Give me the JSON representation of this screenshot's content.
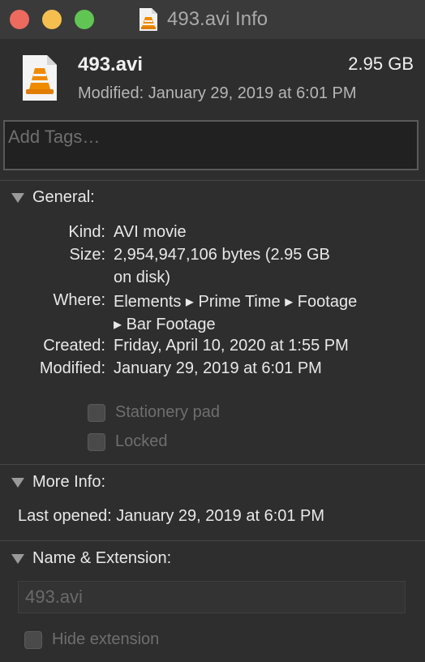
{
  "window": {
    "title": "493.avi Info"
  },
  "file": {
    "name": "493.avi",
    "size": "2.95 GB",
    "modified_line": "Modified: January 29, 2019 at 6:01 PM",
    "icon": "vlc-document-icon"
  },
  "tags": {
    "placeholder": "Add Tags…"
  },
  "general": {
    "heading": "General:",
    "rows": [
      {
        "label": "Kind:",
        "value": "AVI movie"
      },
      {
        "label": "Size:",
        "value": "2,954,947,106 bytes (2.95 GB",
        "value2": "on disk)"
      },
      {
        "label": "Where:",
        "value": "Elements ▸ Prime Time ▸ Footage",
        "value2": "▸ Bar Footage"
      },
      {
        "label": "Created:",
        "value": "Friday, April 10, 2020 at 1:55 PM"
      },
      {
        "label": "Modified:",
        "value": "January 29, 2019 at 6:01 PM"
      }
    ],
    "stationery_label": "Stationery pad",
    "locked_label": "Locked"
  },
  "more_info": {
    "heading": "More Info:",
    "last_opened_label": "Last opened:",
    "last_opened_value": "January 29, 2019 at 6:01 PM"
  },
  "name_extension": {
    "heading": "Name & Extension:",
    "value": "493.avi",
    "hide_extension_label": "Hide extension"
  },
  "colors": {
    "close": "#ed6a5e",
    "minimize": "#f5bf4f",
    "maximize": "#61c554",
    "vlc_orange": "#f08a00"
  }
}
